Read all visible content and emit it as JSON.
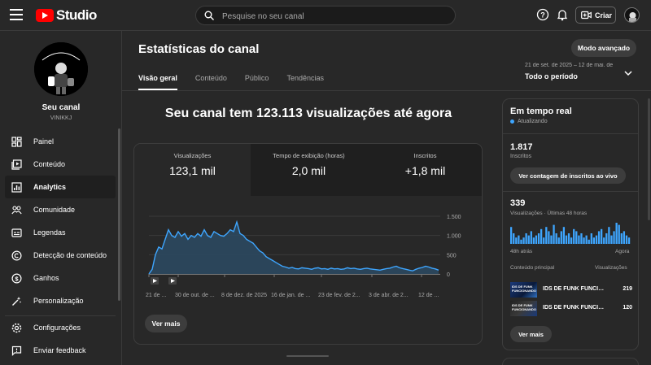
{
  "app": {
    "logo_text": "Studio"
  },
  "search": {
    "placeholder": "Pesquise no seu canal"
  },
  "top_actions": {
    "create_label": "Criar"
  },
  "channel": {
    "name": "Seu canal",
    "handle": "VINIKKJ",
    "avatar_text": "VINI KKJ"
  },
  "sidebar": {
    "items": [
      {
        "label": "Painel",
        "icon": "dashboard-icon"
      },
      {
        "label": "Conteúdo",
        "icon": "content-icon"
      },
      {
        "label": "Analytics",
        "icon": "analytics-icon",
        "active": true
      },
      {
        "label": "Comunidade",
        "icon": "community-icon"
      },
      {
        "label": "Legendas",
        "icon": "subtitles-icon"
      },
      {
        "label": "Detecção de conteúdo",
        "icon": "copyright-icon"
      },
      {
        "label": "Ganhos",
        "icon": "earn-icon"
      },
      {
        "label": "Personalização",
        "icon": "customization-icon"
      }
    ],
    "bottom": [
      {
        "label": "Configurações",
        "icon": "settings-icon"
      },
      {
        "label": "Enviar feedback",
        "icon": "feedback-icon"
      }
    ]
  },
  "header": {
    "title": "Estatísticas do canal",
    "tabs": [
      "Visão geral",
      "Conteúdo",
      "Público",
      "Tendências"
    ],
    "advanced_button": "Modo avançado",
    "period_range": "21 de set. de 2025 – 12 de mai. de 2026",
    "period_label": "Todo o período"
  },
  "main": {
    "headline": "Seu canal tem 123.113 visualizações até agora",
    "metrics": [
      {
        "label": "Visualizações",
        "value": "123,1 mil"
      },
      {
        "label": "Tempo de exibição (horas)",
        "value": "2,0 mil"
      },
      {
        "label": "Inscritos",
        "value": "+1,8 mil"
      }
    ],
    "see_more": "Ver mais"
  },
  "chart_data": {
    "type": "area",
    "series": [
      {
        "values": [
          0,
          120,
          500,
          700,
          650,
          900,
          1150,
          1000,
          950,
          1100,
          980,
          1050,
          900,
          1000,
          950,
          1050,
          980,
          1150,
          1000,
          950,
          1100,
          1050,
          1000,
          980,
          1050,
          1150,
          1100,
          1350,
          1050,
          1000,
          900,
          850,
          800,
          700,
          600,
          550,
          450,
          400,
          350,
          300,
          250,
          200,
          180,
          150,
          170,
          140,
          130,
          160,
          150,
          140,
          120,
          150,
          160,
          130,
          140,
          120,
          150,
          130,
          140,
          120,
          130,
          160,
          140,
          150,
          130,
          120,
          140,
          150,
          130,
          120,
          110,
          100,
          120,
          140,
          150,
          180,
          200,
          160,
          140,
          120,
          100,
          80,
          120,
          150,
          170,
          200,
          180,
          150,
          130,
          100
        ]
      }
    ],
    "x_tick_labels": [
      "21 de ...",
      "30 de out. de ...",
      "8 de dez. de 2025",
      "16 de jan. de ...",
      "23 de fev. de 2...",
      "3 de abr. de 2...",
      "12 de ..."
    ],
    "y_tick_labels": [
      "1.500",
      "1.000",
      "500",
      "0"
    ],
    "ylim": [
      0,
      1500
    ],
    "grid": true,
    "color": "#3ea6ff"
  },
  "realtime": {
    "title": "Em tempo real",
    "status": "Atualizando",
    "subscribers": "1.817",
    "subscribers_label": "Inscritos",
    "live_count_button": "Ver contagem de inscritos ao vivo",
    "views": "339",
    "views_label": "Visualizações · Últimas 48 horas",
    "axis_left": "48h atrás",
    "axis_right": "Agora",
    "bar_values": [
      8,
      5,
      3,
      4,
      2,
      3,
      5,
      4,
      6,
      3,
      4,
      5,
      7,
      3,
      8,
      6,
      4,
      9,
      5,
      3,
      6,
      8,
      4,
      5,
      3,
      7,
      6,
      4,
      5,
      3,
      4,
      2,
      5,
      3,
      4,
      6,
      7,
      3,
      5,
      8,
      4,
      6,
      10,
      9,
      5,
      6,
      4,
      3
    ],
    "table_header_left": "Conteúdo principal",
    "table_header_right": "Visualizações",
    "videos": [
      {
        "title": "IDS DE FUNK FUNCIONANDO",
        "views": "219"
      },
      {
        "title": "IDS DE FUNK FUNCIONANDO",
        "views": "120"
      }
    ],
    "see_more": "Ver mais"
  }
}
